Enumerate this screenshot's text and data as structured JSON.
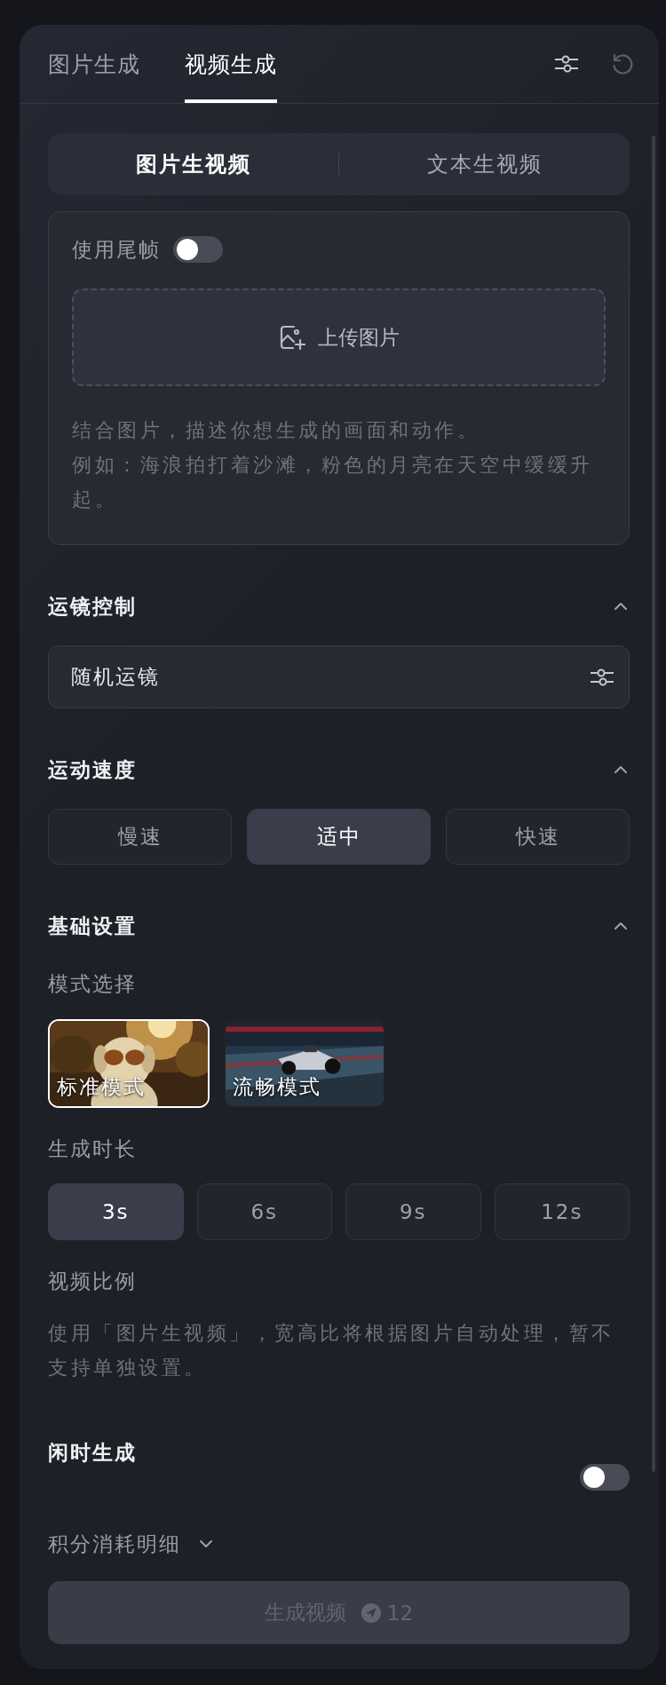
{
  "top_tabs": [
    {
      "label": "图片生成",
      "selected": false
    },
    {
      "label": "视频生成",
      "selected": true
    }
  ],
  "mode_tabs": [
    {
      "label": "图片生视频",
      "selected": true
    },
    {
      "label": "文本生视频",
      "selected": false
    }
  ],
  "end_frame": {
    "label": "使用尾帧",
    "on": false
  },
  "upload": {
    "label": "上传图片"
  },
  "prompt": {
    "placeholder": "结合图片，描述你想生成的画面和动作。",
    "example": "例如：海浪拍打着沙滩，粉色的月亮在天空中缓缓升起。"
  },
  "camera": {
    "title": "运镜控制",
    "expanded": true,
    "value": "随机运镜"
  },
  "speed": {
    "title": "运动速度",
    "expanded": true,
    "options": [
      {
        "label": "慢速",
        "selected": false
      },
      {
        "label": "适中",
        "selected": true
      },
      {
        "label": "快速",
        "selected": false
      }
    ]
  },
  "basic": {
    "title": "基础设置",
    "expanded": true,
    "mode_label": "模式选择",
    "modes": [
      {
        "label": "标准模式",
        "selected": true,
        "kind": "picture"
      },
      {
        "label": "流畅模式",
        "selected": false,
        "kind": "picture"
      }
    ],
    "duration_label": "生成时长",
    "durations": [
      {
        "label": "3s",
        "selected": true
      },
      {
        "label": "6s",
        "selected": false
      },
      {
        "label": "9s",
        "selected": false
      },
      {
        "label": "12s",
        "selected": false
      }
    ],
    "ratio_label": "视频比例",
    "ratio_note": "使用「图片生视频」，宽高比将根据图片自动处理，暂不支持单独设置。"
  },
  "idle": {
    "title": "闲时生成",
    "on": false
  },
  "cost_details": {
    "label": "积分消耗明细",
    "expanded": false
  },
  "generate": {
    "label": "生成视频",
    "cost": "12",
    "disabled": true
  }
}
